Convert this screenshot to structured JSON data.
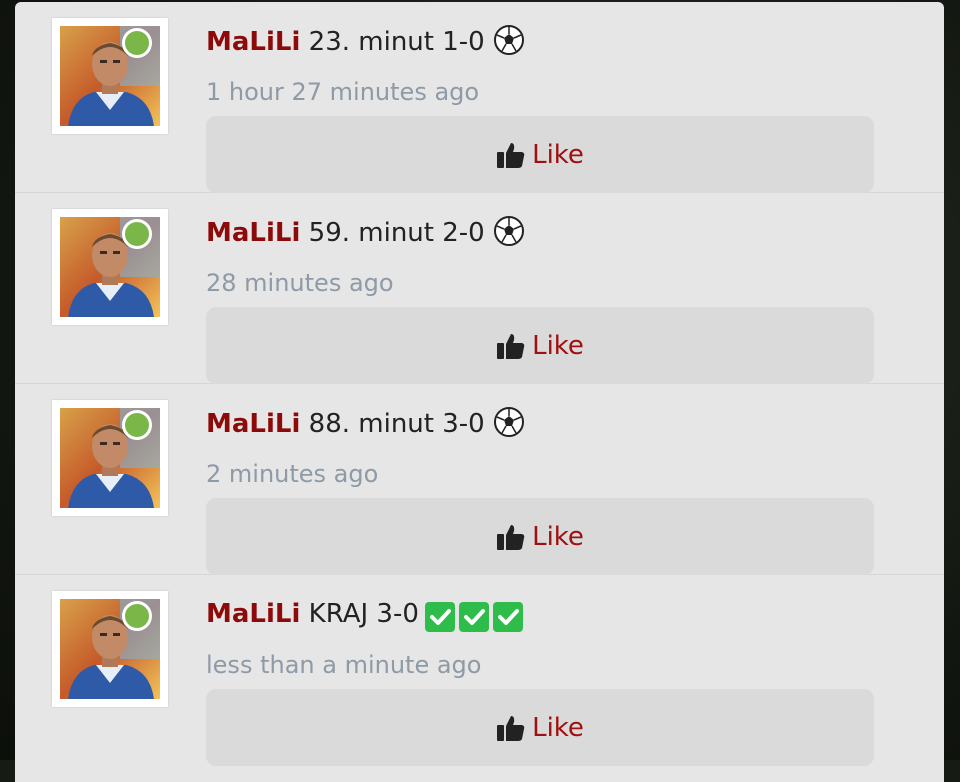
{
  "feed": {
    "colors": {
      "username": "#8d0a0a",
      "like": "#a01010",
      "timestamp": "#8e9aa6",
      "online": "#7ab648",
      "check": "#2ebd4a"
    },
    "comments": [
      {
        "username": "MaLiLi",
        "text": "23. minut 1-0",
        "emoji": "soccer-ball-icon",
        "time": "1 hour 27 minutes ago",
        "like_label": "Like"
      },
      {
        "username": "MaLiLi",
        "text": "59. minut 2-0",
        "emoji": "soccer-ball-icon",
        "time": "28 minutes ago",
        "like_label": "Like"
      },
      {
        "username": "MaLiLi",
        "text": "88. minut 3-0",
        "emoji": "soccer-ball-icon",
        "time": "2 minutes ago",
        "like_label": "Like"
      },
      {
        "username": "MaLiLi",
        "text": "KRAJ 3-0",
        "emoji": "check-mark-icons",
        "time": "less than a minute ago",
        "like_label": "Like"
      }
    ]
  }
}
